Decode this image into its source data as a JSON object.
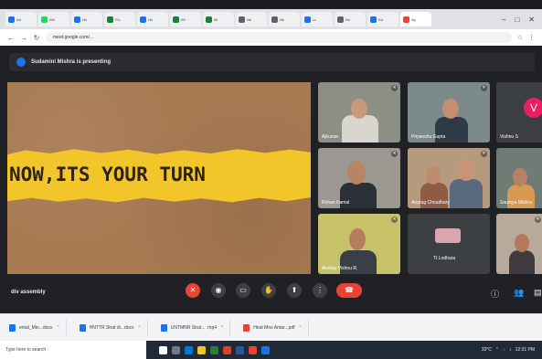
{
  "browser": {
    "tabs": [
      {
        "label": "Ad",
        "color": "#1a73e8"
      },
      {
        "label": "Wh",
        "color": "#25d366"
      },
      {
        "label": "Ho",
        "color": "#1a73e8"
      },
      {
        "label": "Flo",
        "color": "#188038"
      },
      {
        "label": "Ho",
        "color": "#1a73e8"
      },
      {
        "label": "Wi",
        "color": "#188038"
      },
      {
        "label": "Mi",
        "color": "#188038"
      },
      {
        "label": "Ne",
        "color": "#5f6368"
      },
      {
        "label": "Ne",
        "color": "#5f6368"
      },
      {
        "label": "Lo",
        "color": "#1a73e8"
      },
      {
        "label": "Re",
        "color": "#5f6368"
      },
      {
        "label": "Ed",
        "color": "#1a73e8"
      },
      {
        "label": "Ap",
        "color": "#ea4335"
      }
    ],
    "url": "meet.google.com/..."
  },
  "meet": {
    "present_banner": "Sudamini Mishra is presenting",
    "slide_text": "NOW,ITS YOUR TURN",
    "participants": [
      {
        "name": "Ajkumar",
        "kind": "video"
      },
      {
        "name": "Priyanshu Gupta",
        "kind": "video"
      },
      {
        "name": "Vishnu S",
        "kind": "avatar",
        "initial": "V",
        "avatar_color": "#e91e63"
      },
      {
        "name": "Rohan Kamal",
        "kind": "video"
      },
      {
        "name": "Anurag Choudhary",
        "kind": "video"
      },
      {
        "name": "Saumya Mishra",
        "kind": "video"
      },
      {
        "name": "Akshay Vishnu R.",
        "kind": "video"
      },
      {
        "name": "Tt Lodhara",
        "kind": "video"
      },
      {
        "name": "",
        "kind": "video"
      }
    ],
    "meeting_name": "div assembly"
  },
  "downloads": [
    {
      "label": "ental_Min...docx",
      "color": "#1a73e8"
    },
    {
      "label": "HNTTR Strat di...docx",
      "color": "#1a73e8"
    },
    {
      "label": "UNTMNR Strat... .mp4",
      "color": "#1a73e8"
    },
    {
      "label": "Heat Mos Antar...pdf",
      "color": "#ea4335"
    }
  ],
  "taskbar": {
    "search_placeholder": "Type here to search",
    "temperature": "33°C",
    "time": "12:31 PM"
  }
}
